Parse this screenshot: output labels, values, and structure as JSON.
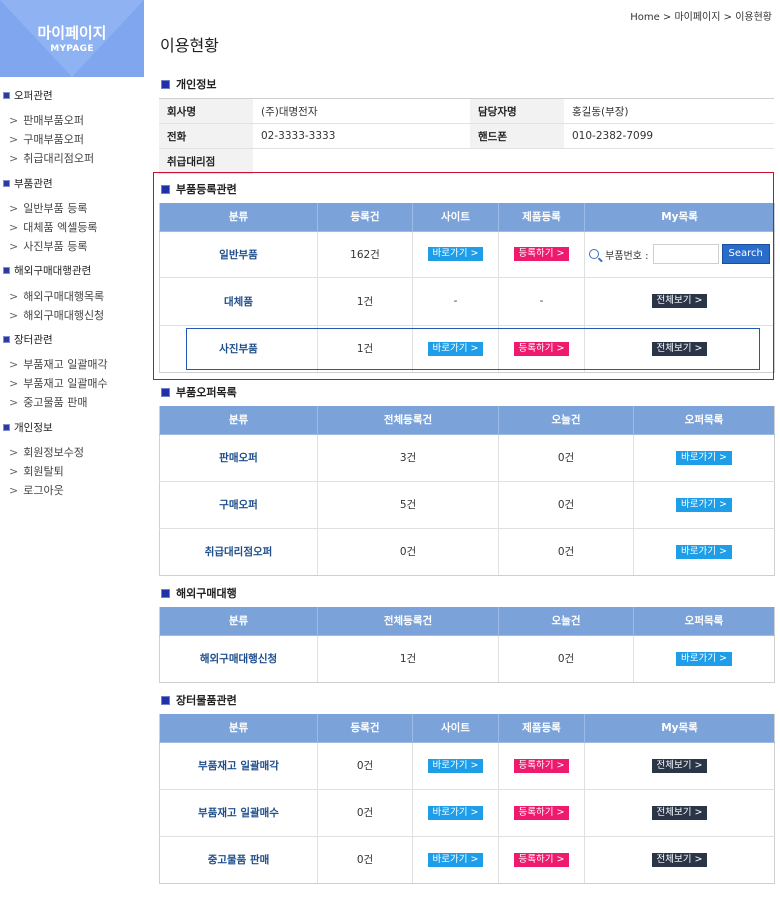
{
  "sidebar": {
    "title": "마이페이지",
    "subtitle": "MYPAGE",
    "groups": [
      {
        "label": "오퍼관련",
        "items": [
          "판매부품오퍼",
          "구매부품오퍼",
          "취급대리점오퍼"
        ]
      },
      {
        "label": "부품관련",
        "items": [
          "일반부품 등록",
          "대체품 엑셀등록",
          "사진부품 등록"
        ]
      },
      {
        "label": "해외구매대행관련",
        "items": [
          "해외구매대행목록",
          "해외구매대행신청"
        ]
      },
      {
        "label": "장터관련",
        "items": [
          "부품재고 일괄매각",
          "부품재고 일괄매수",
          "중고물품 판매"
        ]
      },
      {
        "label": "개인정보",
        "items": [
          "회원정보수정",
          "회원탈퇴",
          "로그아웃"
        ]
      }
    ]
  },
  "breadcrumb": "Home > 마이페이지 > 이용현황",
  "page_title": "이용현황",
  "personal": {
    "title": "개인정보",
    "company_label": "회사명",
    "company": "(주)대명전자",
    "manager_label": "담당자명",
    "manager": "홍길동(부장)",
    "phone_label": "전화",
    "phone": "02-3333-3333",
    "mobile_label": "핸드폰",
    "mobile": "010-2382-7099",
    "agency_label": "취급대리점",
    "agency": ""
  },
  "parts_reg": {
    "title": "부품등록관련",
    "headers": [
      "분류",
      "등록건",
      "사이트",
      "제품등록",
      "My목록"
    ],
    "rows": [
      {
        "name": "일반부품",
        "count": "162건"
      },
      {
        "name": "대체품",
        "count": "1건",
        "site": "-",
        "reg": "-"
      },
      {
        "name": "사진부품",
        "count": "1건"
      }
    ],
    "search_label": "부품번호 :",
    "search_button": "Search",
    "search_value": ""
  },
  "parts_offer": {
    "title": "부품오퍼목록",
    "headers": [
      "분류",
      "전체등록건",
      "오늘건",
      "오퍼목록"
    ],
    "rows": [
      {
        "name": "판매오퍼",
        "total": "3건",
        "today": "0건"
      },
      {
        "name": "구매오퍼",
        "total": "5건",
        "today": "0건"
      },
      {
        "name": "취급대리점오퍼",
        "total": "0건",
        "today": "0건"
      }
    ]
  },
  "overseas": {
    "title": "해외구매대행",
    "headers": [
      "분류",
      "전체등록건",
      "오늘건",
      "오퍼목록"
    ],
    "rows": [
      {
        "name": "해외구매대행신청",
        "total": "1건",
        "today": "0건"
      }
    ]
  },
  "market": {
    "title": "장터물품관련",
    "headers": [
      "분류",
      "등록건",
      "사이트",
      "제품등록",
      "My목록"
    ],
    "rows": [
      {
        "name": "부품재고 일괄매각",
        "count": "0건"
      },
      {
        "name": "부품재고 일괄매수",
        "count": "0건"
      },
      {
        "name": "중고물품 판매",
        "count": "0건"
      }
    ]
  },
  "buttons": {
    "go": "바로가기 >",
    "register": "등록하기 >",
    "view_all": "전체보기 >"
  },
  "colors": {
    "header_blue": "#7ba3d9",
    "btn_blue": "#1e9ee8",
    "btn_pink": "#ee1a6e",
    "btn_dark": "#2b3548"
  }
}
